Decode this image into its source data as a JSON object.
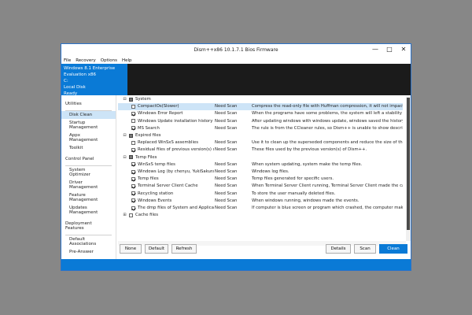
{
  "window": {
    "title": "Dism++x86 10.1.7.1 Bios Firmware",
    "controls": {
      "minimize": "—",
      "maximize": "□",
      "close": "✕"
    }
  },
  "menu": [
    "File",
    "Recovery",
    "Options",
    "Help"
  ],
  "info": {
    "os": "Windows 8.1 Enterprise Evaluation x86",
    "drive": "C:",
    "disk": "Local Disk",
    "state": "Ready"
  },
  "sidebar": {
    "groups": [
      {
        "title": "Utilities",
        "items": [
          "Disk Clean",
          "Startup Management",
          "Appx Management",
          "Toolkit"
        ]
      },
      {
        "title": "Control Panel",
        "items": [
          "System Optimizer",
          "Driver Management",
          "Feature Management",
          "Updates Management"
        ]
      },
      {
        "title": "Deployment Features",
        "items": [
          "Default Associations",
          "Pre-Answer"
        ]
      }
    ],
    "active_item": "Disk Clean"
  },
  "list": {
    "categories": [
      {
        "name": "System",
        "expander": "⊟",
        "items": [
          {
            "name": "CompactOs(Slower)",
            "status": "Need Scan",
            "desc": "Compress the read-only file with Huffman compression, it will not impact the perfo",
            "checked": false,
            "selected": true
          },
          {
            "name": "Windows Error Report",
            "status": "Need Scan",
            "desc": "When the programs have some problems, the system will left a stability report her",
            "checked": true
          },
          {
            "name": "Windows Update installation history",
            "status": "Need Scan",
            "desc": "After updating windows with windows update, windows saved the history.",
            "checked": false
          },
          {
            "name": "MS Search",
            "status": "Need Scan",
            "desc": "The rule is from the CCleaner rules, so Dism++ is unable to show description(s).",
            "checked": true
          }
        ]
      },
      {
        "name": "Expired files",
        "expander": "⊟",
        "items": [
          {
            "name": "Replaced WinSxS assemblies",
            "status": "Need Scan",
            "desc": "Use it to clean up the superseded components and reduce the size of the compor",
            "checked": false
          },
          {
            "name": "Residual files of previous version(s) of Dism",
            "status": "Need Scan",
            "desc": "These files used by the previous version(s) of Dism++.",
            "checked": true
          }
        ]
      },
      {
        "name": "Temp Files",
        "expander": "⊟",
        "items": [
          {
            "name": "WinSxS temp files",
            "status": "Need Scan",
            "desc": "When system updating, system make the temp files.",
            "checked": true
          },
          {
            "name": "Windows Log (by chenyu, YukiSakura)",
            "status": "Need Scan",
            "desc": "Windows log files.",
            "checked": true
          },
          {
            "name": "Temp files",
            "status": "Need Scan",
            "desc": "Temp files generated for specific users.",
            "checked": true
          },
          {
            "name": "Terminal Server Client Cache",
            "status": "Need Scan",
            "desc": "When Terminal Server Client running, Terminal Server Client made the cache.",
            "checked": true
          },
          {
            "name": "Recycling station",
            "status": "Need Scan",
            "desc": "To store the user manually deleted files.",
            "checked": true
          },
          {
            "name": "Windows Events",
            "status": "Need Scan",
            "desc": "When windows running, windows made the events.",
            "checked": true
          },
          {
            "name": "The dmp files of System and Applications (Prog",
            "status": "Need Scan",
            "desc": "If computer is blue screen or program which crashed, the computer make dmp file",
            "checked": true
          }
        ]
      },
      {
        "name": "Cache files",
        "expander": "⊞",
        "items": []
      }
    ]
  },
  "buttons": {
    "none": "None",
    "default": "Default",
    "refresh": "Refresh",
    "details": "Details",
    "scan": "Scan",
    "clean": "Clean"
  }
}
